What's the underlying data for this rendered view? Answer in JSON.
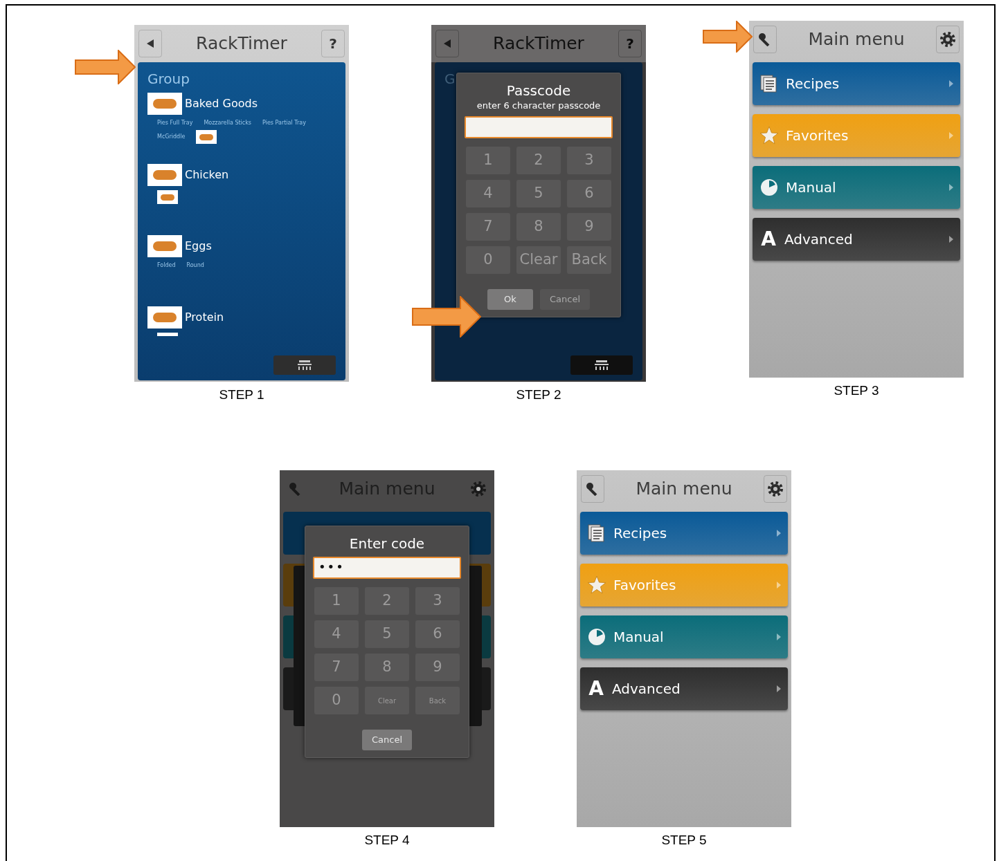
{
  "steps": [
    {
      "caption": "STEP 1",
      "arrow": true,
      "screen": {
        "kind": "group_list",
        "header": {
          "title": "RackTimer",
          "help": "?"
        },
        "heading": "Group",
        "footer_button": true,
        "groups": [
          {
            "name": "Baked Goods",
            "items": [
              {
                "kind": "label",
                "text": "Pies Full Tray"
              },
              {
                "kind": "label",
                "text": "Mozzarella Sticks"
              },
              {
                "kind": "label",
                "text": "Pies Partial Tray"
              },
              {
                "kind": "label",
                "text": "McGriddle"
              },
              {
                "kind": "thumb"
              }
            ]
          },
          {
            "name": "Chicken",
            "items": [
              {
                "kind": "thumb"
              }
            ]
          },
          {
            "name": "Eggs",
            "items": [
              {
                "kind": "label",
                "text": "Folded"
              },
              {
                "kind": "label",
                "text": "Round"
              }
            ]
          },
          {
            "name": "Protein",
            "items": [
              {
                "kind": "strip"
              }
            ]
          }
        ]
      }
    },
    {
      "caption": "STEP 2",
      "arrow": true,
      "screen": {
        "kind": "group_list_dimmed",
        "header": {
          "title": "RackTimer",
          "help": "?"
        },
        "heading_fragment": "G",
        "footer_button": true,
        "dialog": {
          "title": "Passcode",
          "subtitle": "enter 6 character passcode",
          "compact_actions": false,
          "keys": [
            "1",
            "2",
            "3",
            "4",
            "5",
            "6",
            "7",
            "8",
            "9",
            "0",
            "Clear",
            "Back"
          ],
          "buttons": [
            {
              "label": "Ok",
              "highlighted": true
            },
            {
              "label": "Cancel",
              "highlighted": false
            }
          ]
        }
      }
    },
    {
      "caption": "STEP 3",
      "arrow": true,
      "screen": {
        "kind": "main_menu",
        "header": {
          "title": "Main menu"
        },
        "items": [
          {
            "label": "Recipes",
            "kind": "documents",
            "color": "#0a5a98"
          },
          {
            "label": "Favorites",
            "kind": "star",
            "color": "#f0a012"
          },
          {
            "label": "Manual",
            "kind": "dial",
            "color": "#0b6d7a"
          },
          {
            "label": "Advanced",
            "kind": "letter",
            "glyph": "A",
            "color": "#2e2e2e"
          }
        ]
      }
    },
    {
      "caption": "STEP 4",
      "screen": {
        "kind": "main_menu_dimmed",
        "header": {
          "title": "Main menu"
        },
        "bars": [
          {
            "color": "#06304f"
          },
          {
            "color": "#5a3d0c"
          },
          {
            "color": "#0a3a40"
          },
          {
            "color": "#1a1a1a"
          }
        ],
        "dialog": {
          "title": "Enter code",
          "value": "•••",
          "compact_actions": true,
          "keys": [
            "1",
            "2",
            "3",
            "4",
            "5",
            "6",
            "7",
            "8",
            "9",
            "0",
            "Clear",
            "Back"
          ],
          "buttons": [
            {
              "label": "Cancel",
              "highlighted": true
            }
          ]
        }
      }
    },
    {
      "caption": "STEP 5",
      "screen": {
        "kind": "main_menu",
        "header": {
          "title": "Main menu"
        },
        "items": [
          {
            "label": "Recipes",
            "kind": "documents",
            "color": "#0a5a98"
          },
          {
            "label": "Favorites",
            "kind": "star",
            "color": "#f0a012"
          },
          {
            "label": "Manual",
            "kind": "dial",
            "color": "#0b6d7a"
          },
          {
            "label": "Advanced",
            "kind": "letter",
            "glyph": "A",
            "color": "#2e2e2e"
          }
        ]
      }
    }
  ]
}
